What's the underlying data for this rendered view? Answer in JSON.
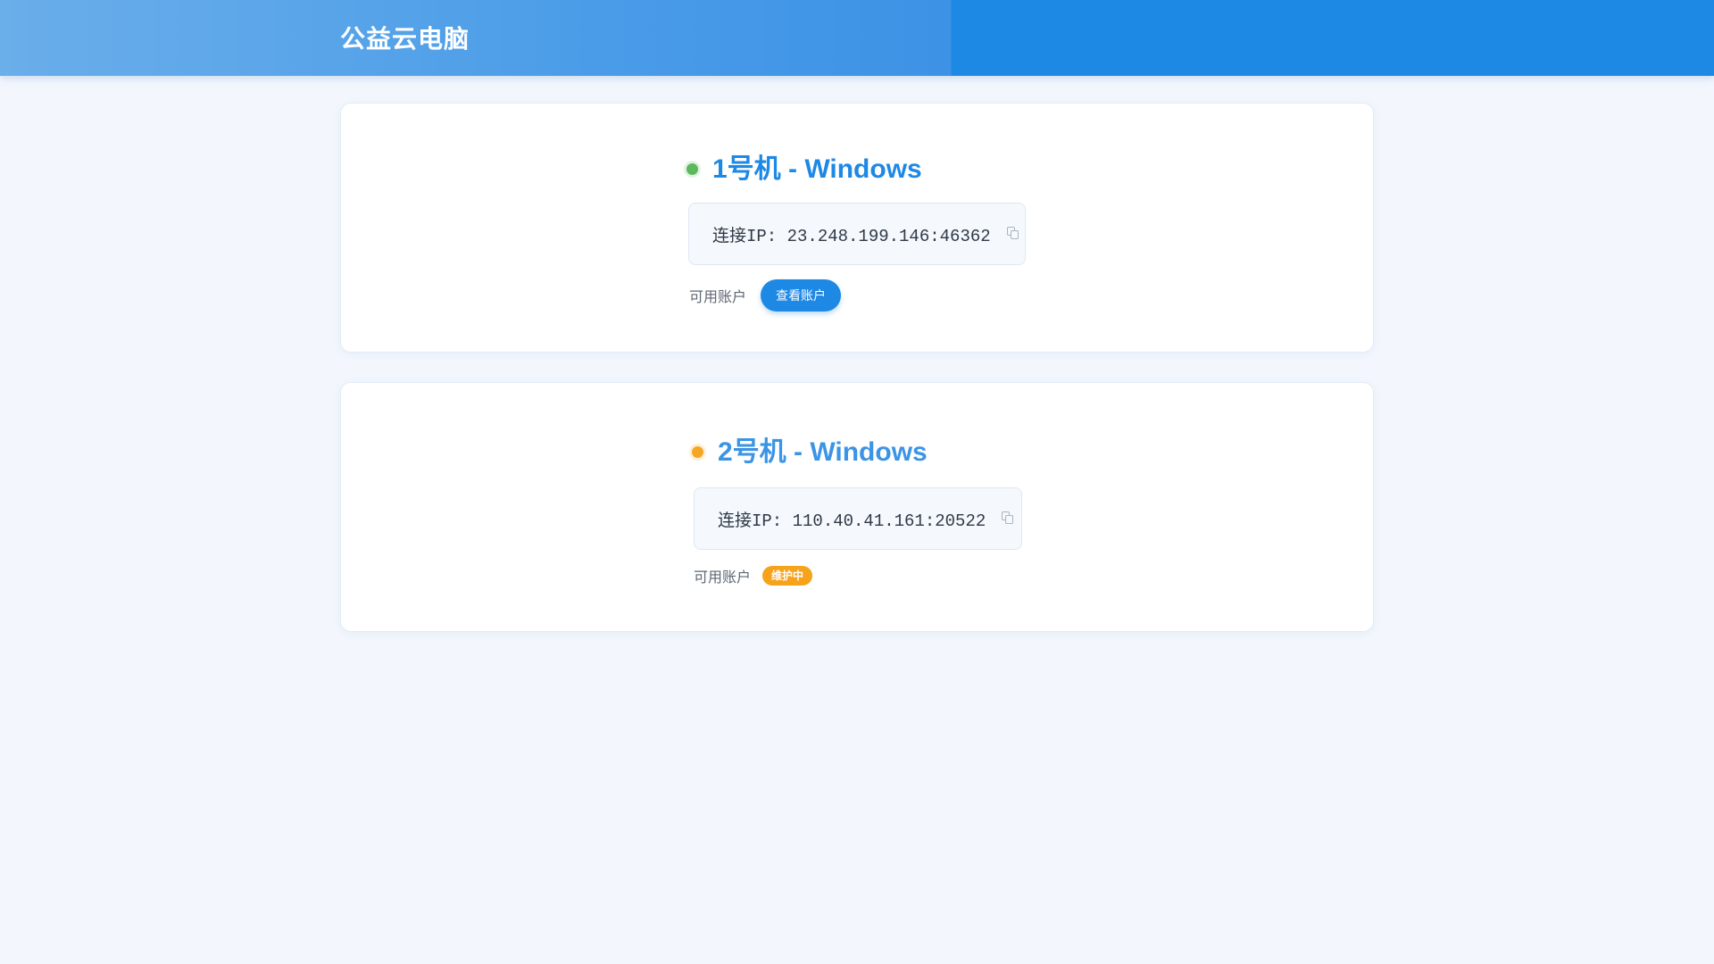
{
  "header": {
    "title": "公益云电脑"
  },
  "machines": [
    {
      "title": "1号机 - Windows",
      "status": "online",
      "status_color": "#5cb85c",
      "title_color": "#1e88e5",
      "ip_text": "连接IP: 23.248.199.146:46362",
      "copy_icon": "copy-icon",
      "account_label": "可用账户",
      "view_button_label": "查看账户"
    },
    {
      "title": "2号机 - Windows",
      "status": "maintenance",
      "status_color": "#f5a623",
      "title_color": "#3b94e5",
      "ip_text": "连接IP: 110.40.41.161:20522",
      "copy_icon": "copy-icon",
      "account_label": "可用账户",
      "maintenance_badge": "维护中"
    }
  ],
  "colors": {
    "accent": "#1e88e5",
    "background": "#f3f7fd",
    "warning": "#f7a21b"
  }
}
